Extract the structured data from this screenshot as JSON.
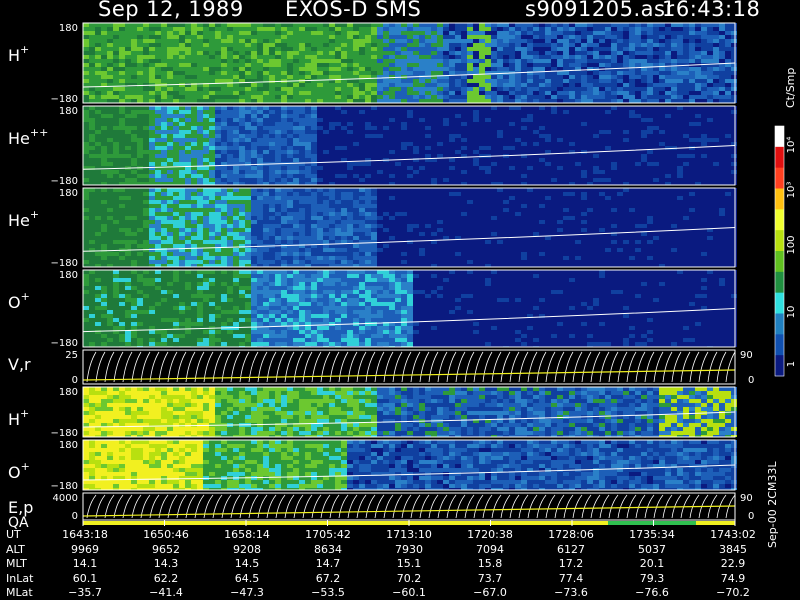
{
  "header": {
    "date": "Sep 12, 1989",
    "mission": "EXOS-D SMS",
    "file": "s9091205.asr",
    "time": "16:43:18"
  },
  "colorbar": {
    "title": "Ct/Smp",
    "tick_labels": [
      "10⁴",
      "10³",
      "100",
      "10",
      "1"
    ],
    "colors": [
      "#ffffff",
      "#e01010",
      "#ff4020",
      "#ffc010",
      "#f0ff30",
      "#b8e010",
      "#60c020",
      "#209040",
      "#30e0e0",
      "#2080c0",
      "#1050b0",
      "#0a1a80"
    ]
  },
  "side_id": "Sep-00 2CM33L",
  "chart_data": {
    "type": "heatmap",
    "x_tick_labels": [
      "1643:18",
      "1650:46",
      "1658:14",
      "1705:42",
      "1713:10",
      "1720:38",
      "1728:06",
      "1735:34",
      "1743:02"
    ],
    "panels": [
      {
        "label": "H",
        "sup": "+",
        "ymax_label": "180",
        "ymin_label": "−180"
      },
      {
        "label": "He",
        "sup": "++",
        "ymax_label": "180",
        "ymin_label": "−180"
      },
      {
        "label": "He",
        "sup": "+",
        "ymax_label": "180",
        "ymin_label": "−180"
      },
      {
        "label": "O",
        "sup": "+",
        "ymax_label": "180",
        "ymin_label": "−180"
      },
      {
        "label": "V,r",
        "sup": "",
        "ymax_label": "25",
        "ymin_label": "0",
        "right_top": "90",
        "right_bottom": "0"
      },
      {
        "label": "H",
        "sup": "+",
        "ymax_label": "180",
        "ymin_label": "−180"
      },
      {
        "label": "O",
        "sup": "+",
        "ymax_label": "180",
        "ymin_label": "−180"
      },
      {
        "label": "E,p",
        "label2": "QA",
        "sup": "",
        "ymax_label": "4000",
        "ymin_label": "0",
        "right_top": "90",
        "right_bottom": "0"
      }
    ],
    "rows": [
      {
        "label": "UT",
        "values": [
          "1643:18",
          "1650:46",
          "1658:14",
          "1705:42",
          "1713:10",
          "1720:38",
          "1728:06",
          "1735:34",
          "1743:02"
        ]
      },
      {
        "label": "ALT",
        "values": [
          "9969",
          "9652",
          "9208",
          "8634",
          "7930",
          "7094",
          "6127",
          "5037",
          "3845"
        ]
      },
      {
        "label": "MLT",
        "values": [
          "14.1",
          "14.3",
          "14.5",
          "14.7",
          "15.1",
          "15.8",
          "17.2",
          "20.1",
          "22.9"
        ]
      },
      {
        "label": "InLat",
        "values": [
          "60.1",
          "62.2",
          "64.5",
          "67.2",
          "70.2",
          "73.7",
          "77.4",
          "79.3",
          "74.9"
        ]
      },
      {
        "label": "MLat",
        "values": [
          "−35.7",
          "−41.4",
          "−47.3",
          "−53.5",
          "−60.1",
          "−67.0",
          "−73.6",
          "−76.6",
          "−70.2"
        ]
      }
    ]
  }
}
